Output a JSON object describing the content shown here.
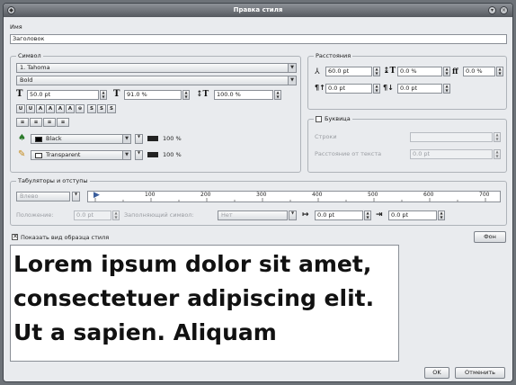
{
  "window": {
    "title": "Правка стиля"
  },
  "name": {
    "label": "Имя",
    "value": "Заголовок"
  },
  "font_group": {
    "title": "Символ",
    "font_family": "1. Tahoma",
    "font_style": "Bold",
    "size_value": "50.0 pt",
    "scale_w_value": "91.0 %",
    "scale_h_value": "100.0 %",
    "effects_buttons": [
      "U",
      "U",
      "A",
      "A",
      "A",
      "A",
      "⊕",
      "S",
      "S",
      "S"
    ],
    "align_buttons": [
      "≡",
      "≡",
      "≡",
      "≡"
    ],
    "fill_color": "Black",
    "fill_shade": "100 %",
    "stroke_color": "Transparent",
    "stroke_shade": "100 %"
  },
  "spacing_group": {
    "title": "Расстояния",
    "tracking_value": "60.0 pt",
    "line_value": "0.0 %",
    "baseline_value": "0.0 %",
    "space_above_value": "0.0 pt",
    "space_below_value": "0.0 pt"
  },
  "dropcap_group": {
    "title": "Буквица",
    "checked": false,
    "lines_label": "Строки",
    "offset_label": "Расстояние от текста",
    "offset_value": "0.0 pt"
  },
  "tabs_group": {
    "title": "Табуляторы и отступы",
    "align_value": "Влево",
    "ruler_marks": [
      "100",
      "200",
      "300",
      "400",
      "500",
      "600",
      "700"
    ],
    "position_label": "Положение:",
    "position_value": "0.0 pt",
    "fill_char_label": "Заполняющий символ:",
    "fill_char_value": "Нет",
    "indent_first_value": "0.0 pt",
    "indent_left_value": "0.0 pt"
  },
  "preview": {
    "show_label": "Показать вид образца стиля",
    "checked": true,
    "bg_button": "Фон",
    "text": "Lorem ipsum dolor sit amet, consectetuer adipiscing elit. Ut a sapien. Aliquam"
  },
  "footer": {
    "ok": "OK",
    "cancel": "Отменить"
  },
  "colors": {
    "fill": "#000000",
    "accent": "#3b5e9c"
  }
}
